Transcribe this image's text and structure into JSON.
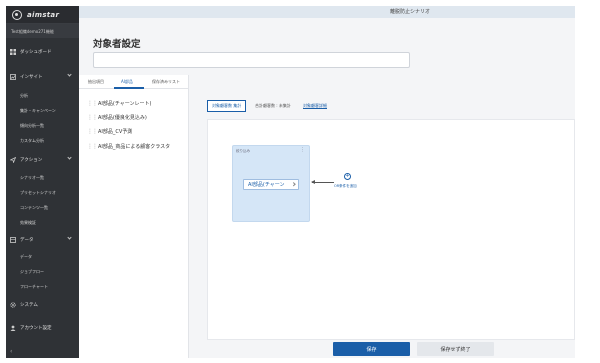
{
  "app": {
    "brand": "aimstar",
    "org": "Test組織demo271機能"
  },
  "topbar": {
    "scenario_title": "離脱防止シナリオ"
  },
  "sidebar": {
    "items": [
      {
        "label": "ダッシュボード",
        "icon": "dashboard-icon"
      },
      {
        "label": "インサイト",
        "icon": "insight-icon",
        "expanded": true
      },
      {
        "label": "アクション",
        "icon": "action-icon",
        "expanded": true
      },
      {
        "label": "データ",
        "icon": "data-icon",
        "expanded": true
      },
      {
        "label": "システム",
        "icon": "gear-icon"
      },
      {
        "label": "アカウント設定",
        "icon": "user-icon"
      }
    ],
    "insight_sub": [
      "分析",
      "集計・キャンペーン",
      "傾向分析一覧",
      "カスタム分析"
    ],
    "action_sub": [
      "シナリオ一覧",
      "プリセットシナリオ",
      "コンテンツ一覧",
      "効果検証"
    ],
    "data_sub": [
      "データ",
      "ジョブフロー",
      "フローチャート"
    ],
    "collapse_glyph": "‹"
  },
  "page": {
    "title": "対象者設定",
    "title_input_value": ""
  },
  "left_panel": {
    "tabs": [
      "抽出項目",
      "AI部品",
      "保存済みリスト"
    ],
    "active_tab": 1,
    "components": [
      "AI部品(チャーンレート)",
      "AI部品(優良化見込み)",
      "AI部品_CV予測",
      "AI部品_商品による顧客クラスタ"
    ]
  },
  "right_panel": {
    "tabs": [
      "対象顧客数 集計",
      "合計顧客数 : 未集計",
      "対象顧客詳細"
    ],
    "active_tab": 0,
    "filter_box": {
      "label": "絞り込み",
      "chip_label": "AI部品(チャーン"
    },
    "add_condition_label": "OR条件を追加"
  },
  "footer": {
    "save_label": "保存",
    "save_exit_label": "保存せず終了"
  },
  "colors": {
    "sidebar_bg": "#2f3236",
    "accent": "#1a5ea8",
    "filter_box_bg": "#d5e6f7"
  }
}
